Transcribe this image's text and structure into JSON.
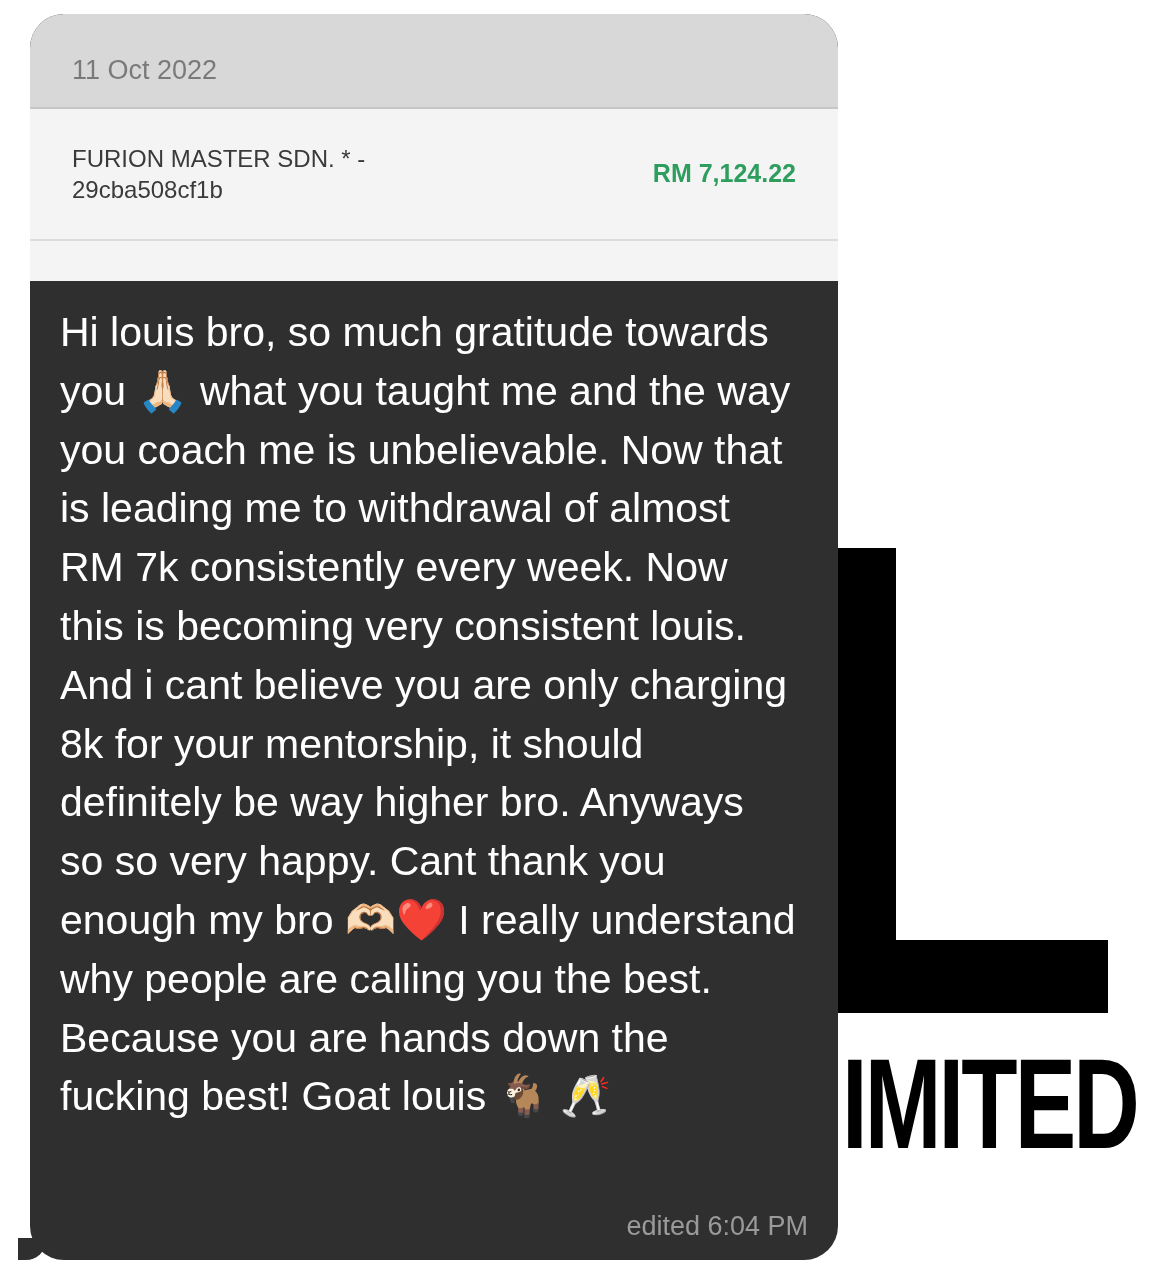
{
  "bank_screenshot": {
    "date": "11 Oct 2022",
    "transaction": {
      "merchant": "FURION MASTER SDN. * - 29cba508cf1b",
      "amount": "RM 7,124.22"
    }
  },
  "message": {
    "text": "Hi louis bro, so much gratitude towards you 🙏🏻 what you taught me and the way you coach me is unbelievable. Now that is leading me to withdrawal of almost RM 7k consistently every week. Now this is becoming very consistent louis. And i cant believe you are only charging 8k for your mentorship, it should definitely be way higher bro. Anyways so so very happy. Cant thank you enough my bro 🫶🏻❤️ I really understand why people are calling you the best. Because you are hands down the fucking best! Goat louis 🐐 🥂",
    "status": "edited 6:04 PM"
  },
  "background_logo": {
    "text": "IMITED"
  }
}
